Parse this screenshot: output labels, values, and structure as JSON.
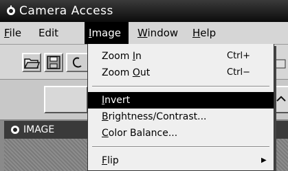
{
  "window": {
    "title": "Camera Access"
  },
  "menubar": {
    "items": [
      {
        "label": "File",
        "accel": "F",
        "rest": "ile"
      },
      {
        "label": "Edit",
        "accel": "",
        "rest": "Edit"
      },
      {
        "label": "Image",
        "accel": "I",
        "rest": "mage"
      },
      {
        "label": "Window",
        "accel": "W",
        "rest": "indow"
      },
      {
        "label": "Help",
        "accel": "H",
        "rest": "elp"
      }
    ]
  },
  "image_menu": {
    "zoom_in": {
      "pre": "Zoom ",
      "accel": "I",
      "rest": "n",
      "shortcut": "Ctrl+"
    },
    "zoom_out": {
      "pre": "Zoom ",
      "accel": "O",
      "rest": "ut",
      "shortcut": "Ctrl−"
    },
    "invert": {
      "accel": "I",
      "rest": "nvert"
    },
    "brightness": {
      "accel": "B",
      "rest": "rightness/Contrast..."
    },
    "color_balance": {
      "accel": "C",
      "rest": "olor Balance..."
    },
    "flip": {
      "accel": "F",
      "rest": "lip"
    }
  },
  "document": {
    "title": "IMAGE"
  },
  "colors": {
    "highlight": "#000000",
    "titlebar": "#1a1a1a",
    "menu_bg": "#efefef"
  }
}
